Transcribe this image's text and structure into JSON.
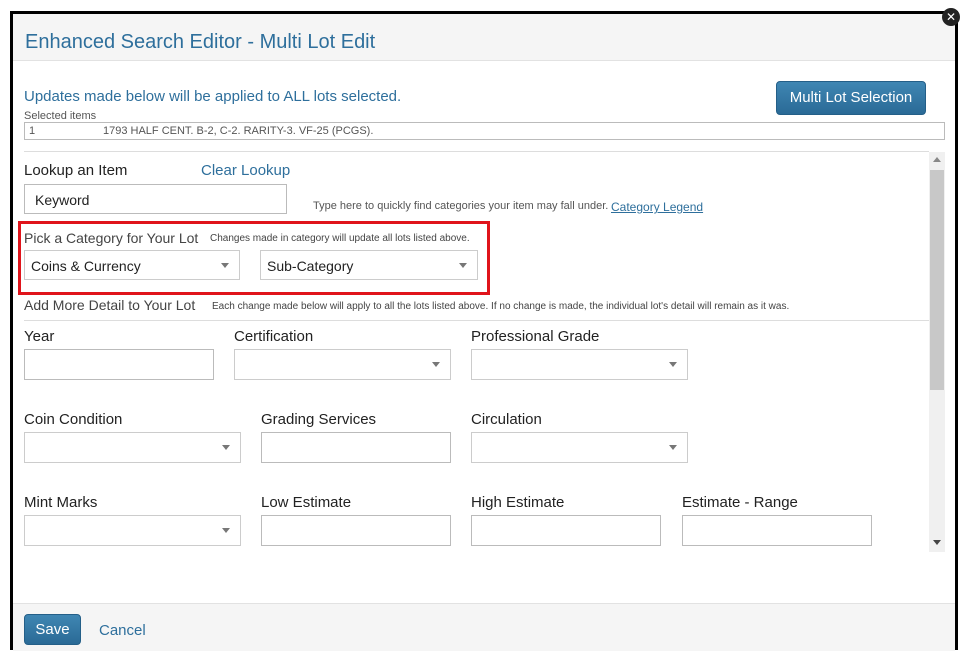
{
  "dialog": {
    "title": "Enhanced Search Editor - Multi Lot Edit",
    "close_glyph": "✕"
  },
  "updates_notice": "Updates made below will be applied to ALL lots selected.",
  "multi_lot_button": "Multi Lot Selection",
  "selected_items": {
    "label": "Selected items",
    "rows": [
      {
        "number": "1",
        "description": "1793 HALF CENT. B-2, C-2. RARITY-3. VF-25 (PCGS)."
      }
    ]
  },
  "lookup": {
    "label": "Lookup an Item",
    "clear_label": "Clear Lookup",
    "keyword_value": "Keyword",
    "hint": "Type here to quickly find categories your item may fall under.",
    "legend_link": "Category Legend"
  },
  "category": {
    "label": "Pick a Category for Your Lot",
    "note": "Changes made in category will update all lots listed above.",
    "category_value": "Coins & Currency",
    "subcategory_value": "Sub-Category",
    "highlight_color": "#e0141b"
  },
  "detail": {
    "label": "Add More Detail to Your Lot",
    "note": "Each change made below will apply to all the lots listed above. If no change is made, the individual lot's detail will remain as it was.",
    "fields": {
      "year": "Year",
      "certification": "Certification",
      "professional_grade": "Professional Grade",
      "coin_condition": "Coin Condition",
      "grading_services": "Grading Services",
      "circulation": "Circulation",
      "mint_marks": "Mint Marks",
      "low_estimate": "Low Estimate",
      "high_estimate": "High Estimate",
      "estimate_range": "Estimate - Range"
    }
  },
  "footer": {
    "save_label": "Save",
    "cancel_label": "Cancel"
  },
  "colors": {
    "accent": "#2e6f9c",
    "button": "#2a6a96"
  }
}
